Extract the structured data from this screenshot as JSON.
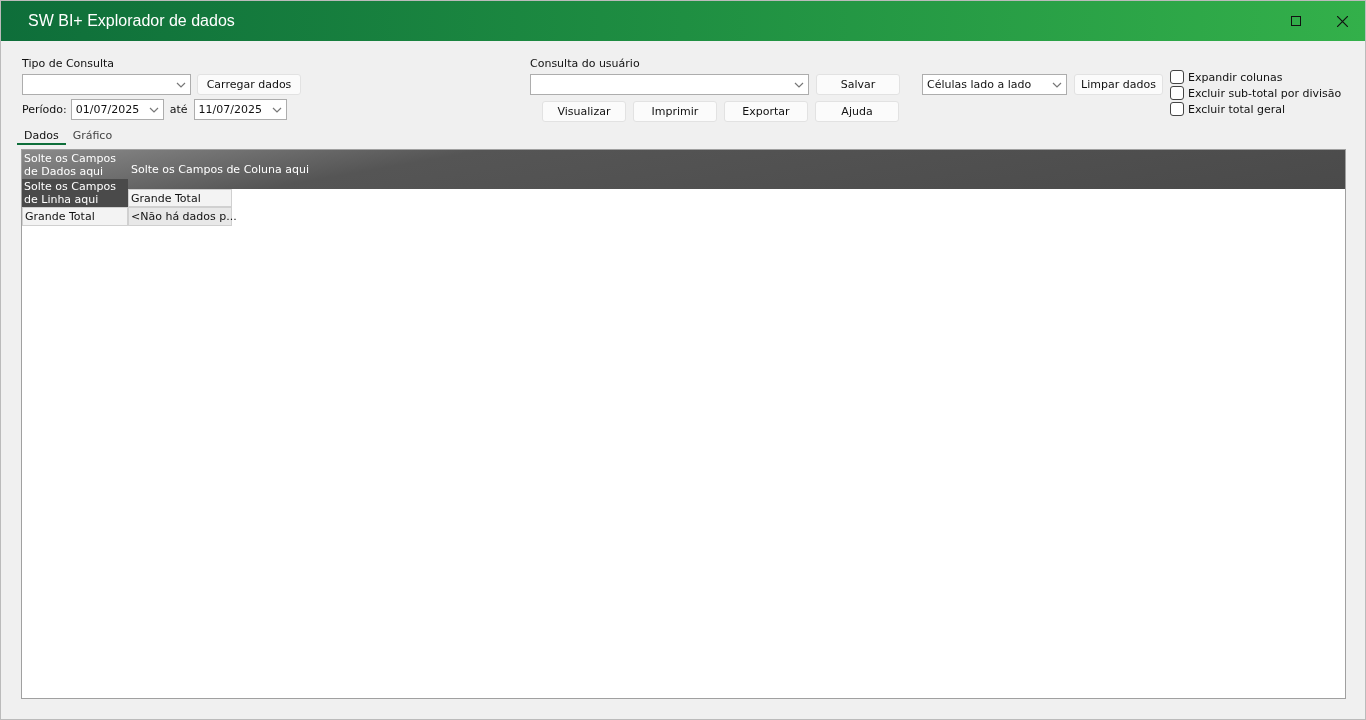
{
  "window": {
    "title": "SW BI+ Explorador de dados"
  },
  "query_type": {
    "label": "Tipo de Consulta"
  },
  "load_button": "Carregar dados",
  "period": {
    "label": "Período:",
    "from": "01/07/2025",
    "separator": "até",
    "to": "11/07/2025"
  },
  "user_query": {
    "label": "Consulta do usuário"
  },
  "buttons": [
    "Salvar",
    "Visualizar",
    "Imprimir",
    "Exportar",
    "Ajuda"
  ],
  "layout_select": {
    "value": "Células lado a lado"
  },
  "clear_button": "Limpar dados",
  "options": [
    {
      "label": "Expandir colunas",
      "checked": false
    },
    {
      "label": "Excluir sub-total por divisão",
      "checked": false
    },
    {
      "label": "Excluir total geral",
      "checked": false
    }
  ],
  "tabs": [
    {
      "label": "Dados",
      "selected": true
    },
    {
      "label": "Gráfico",
      "selected": false
    }
  ],
  "pivot": {
    "data_area": "Solte os Campos de Dados aqui",
    "column_area": "Solte os Campos de Coluna aqui",
    "row_area": "Solte os Campos de Linha aqui",
    "column_header": "Grande Total",
    "row_header": "Grande Total",
    "cell": "<Não há dados p..."
  }
}
